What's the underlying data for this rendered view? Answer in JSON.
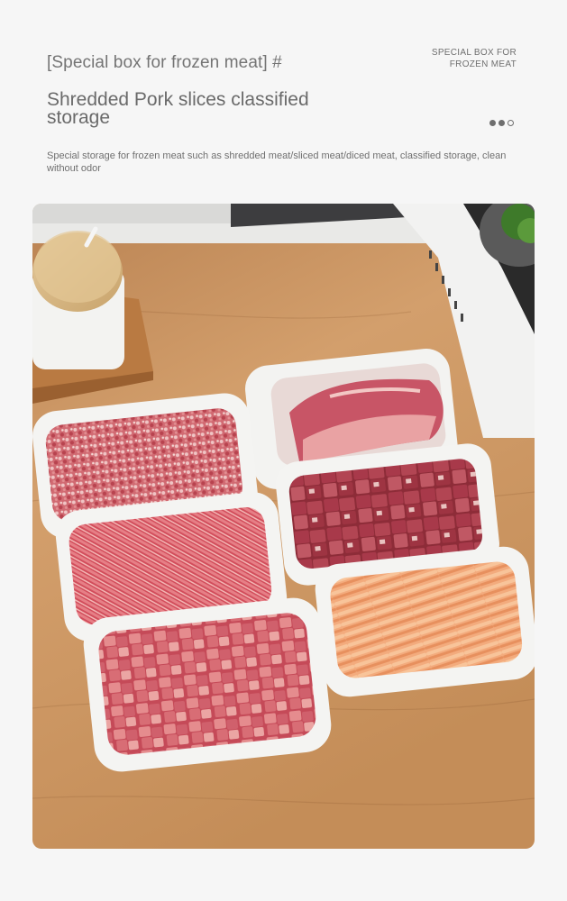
{
  "header": {
    "tag": "[Special box for frozen meat] #",
    "corner_line1": "SPECIAL BOX FOR",
    "corner_line2": "FROZEN MEAT",
    "title_line1": "Shredded Pork slices classified",
    "title_line2": "storage",
    "description": "Special storage for frozen meat such as shredded meat/sliced meat/diced meat, classified storage, clean without odor"
  },
  "pager": {
    "dot_count": 3,
    "active_dots": 2
  },
  "photo": {
    "boxes": [
      "minced-meat",
      "sliced-pork",
      "shredded-meat",
      "diced-meat",
      "diced-pork",
      "chicken-strips"
    ],
    "colors": {
      "table": "#c9935f",
      "box": "#f4f4f2",
      "meat": "#c9505e",
      "chicken": "#f2a675"
    }
  }
}
